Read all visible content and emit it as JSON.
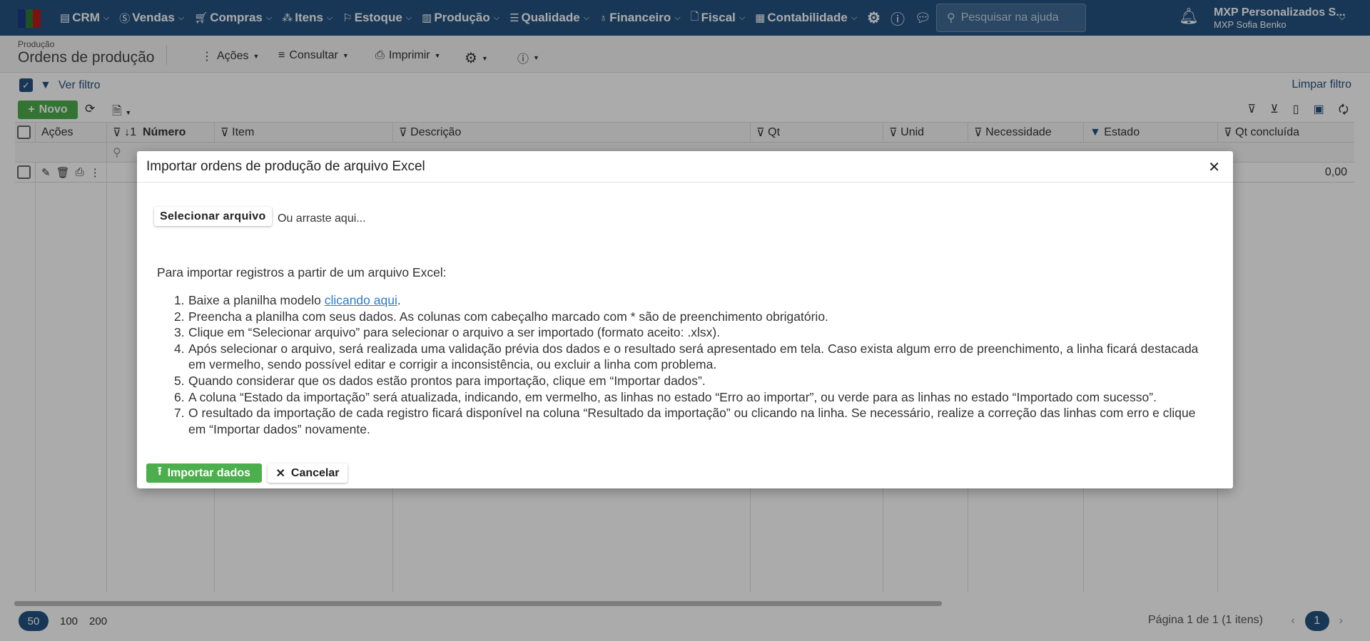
{
  "topnav": {
    "menu": [
      {
        "label": "CRM",
        "icon": "crm-icon"
      },
      {
        "label": "Vendas",
        "icon": "dollar-icon"
      },
      {
        "label": "Compras",
        "icon": "cart-icon"
      },
      {
        "label": "Itens",
        "icon": "items-icon"
      },
      {
        "label": "Estoque",
        "icon": "stock-icon"
      },
      {
        "label": "Produção",
        "icon": "factory-icon"
      },
      {
        "label": "Qualidade",
        "icon": "checklist-icon"
      },
      {
        "label": "Financeiro",
        "icon": "money-bag-icon"
      },
      {
        "label": "Fiscal",
        "icon": "document-icon"
      },
      {
        "label": "Contabilidade",
        "icon": "calculator-icon"
      }
    ],
    "search_placeholder": "Pesquisar na ajuda",
    "company": "MXP Personalizados S...",
    "user": "MXP Sofia Benko"
  },
  "subheader": {
    "breadcrumb": "Produção",
    "title": "Ordens de produção",
    "actions": "Ações",
    "consultar": "Consultar",
    "imprimir": "Imprimir"
  },
  "filter": {
    "ver_filtro": "Ver filtro",
    "limpar_filtro": "Limpar filtro"
  },
  "toolbar": {
    "novo": "Novo"
  },
  "table": {
    "columns": [
      "Ações",
      "↓1",
      "Número",
      "Item",
      "Descrição",
      "Qt",
      "Unid",
      "Necessidade",
      "Estado",
      "Qt concluída"
    ],
    "row": {
      "qt_concluida": "0,00"
    }
  },
  "pagination": {
    "sizes": [
      "50",
      "100",
      "200"
    ],
    "info": "Página 1 de 1 (1 itens)",
    "current": "1"
  },
  "modal": {
    "title": "Importar ordens de produção de arquivo Excel",
    "select_file": "Selecionar arquivo",
    "drag_hint": "Ou arraste aqui...",
    "intro": "Para importar registros a partir de um arquivo Excel:",
    "step1_prefix": "Baixe a planilha modelo ",
    "step1_link": "clicando aqui",
    "step1_suffix": ".",
    "steps": [
      "Preencha a planilha com seus dados. As colunas com cabeçalho marcado com * são de preenchimento obrigatório.",
      "Clique em “Selecionar arquivo” para selecionar o arquivo a ser importado (formato aceito: .xlsx).",
      "Após selecionar o arquivo, será realizada uma validação prévia dos dados e o resultado será apresentado em tela. Caso exista algum erro de preenchimento, a linha ficará destacada em vermelho, sendo possível editar e corrigir a inconsistência, ou excluir a linha com problema.",
      "Quando considerar que os dados estão prontos para importação, clique em “Importar dados”.",
      "A coluna “Estado da importação” será atualizada, indicando, em vermelho, as linhas no estado “Erro ao importar”, ou verde para as linhas no estado “Importado com sucesso”.",
      "O resultado da importação de cada registro ficará disponível na coluna “Resultado da importação” ou clicando na linha. Se necessário, realize a correção das linhas com erro e clique em “Importar dados” novamente."
    ],
    "import_button": "Importar dados",
    "cancel_button": "Cancelar"
  },
  "colors": {
    "brand": "#245380",
    "success": "#4cae4c",
    "link": "#2a7bd0"
  }
}
